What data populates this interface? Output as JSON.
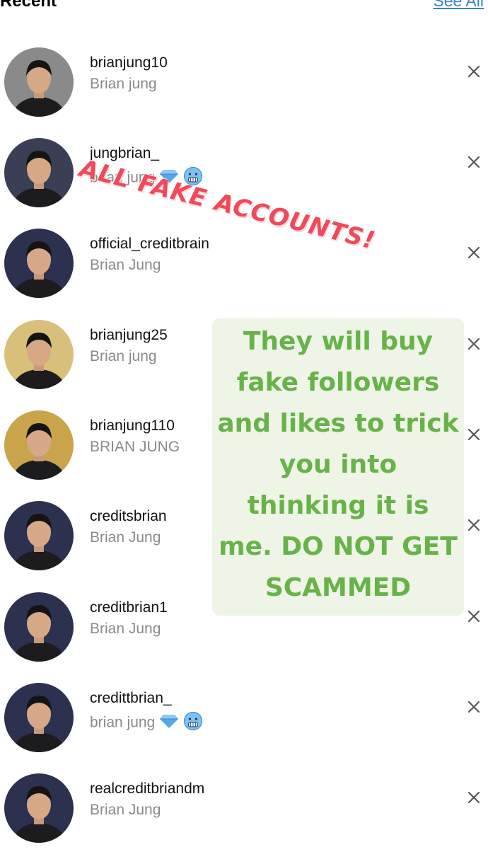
{
  "header": {
    "title": "Recent",
    "see_all": "See All"
  },
  "accounts": [
    {
      "username": "brianjung10",
      "name": "Brian jung",
      "badges": []
    },
    {
      "username": "jungbrian_",
      "name": "brian jung",
      "badges": [
        "diamond-icon",
        "cold-face-icon"
      ]
    },
    {
      "username": "official_creditbrain",
      "name": "Brian Jung",
      "badges": []
    },
    {
      "username": "brianjung25",
      "name": "Brian jung",
      "badges": []
    },
    {
      "username": "brianjung110",
      "name": "BRIAN JUNG",
      "badges": []
    },
    {
      "username": "creditsbrian",
      "name": "Brian Jung",
      "badges": []
    },
    {
      "username": "creditbrian1",
      "name": "Brian Jung",
      "badges": []
    },
    {
      "username": "credittbrian_",
      "name": "brian jung",
      "badges": [
        "diamond-icon",
        "cold-face-icon"
      ]
    },
    {
      "username": "realcreditbriandm",
      "name": "Brian Jung",
      "badges": []
    }
  ],
  "overlays": {
    "red_text": "ALL FAKE ACCOUNTS!",
    "green_text": "They will buy fake followers and likes to trick you into thinking it is me. DO NOT GET SCAMMED"
  },
  "colors": {
    "link": "#3b82c9",
    "warning_red": "#f04a5a",
    "note_green": "#67b349",
    "note_bg": "#eef5e7"
  }
}
